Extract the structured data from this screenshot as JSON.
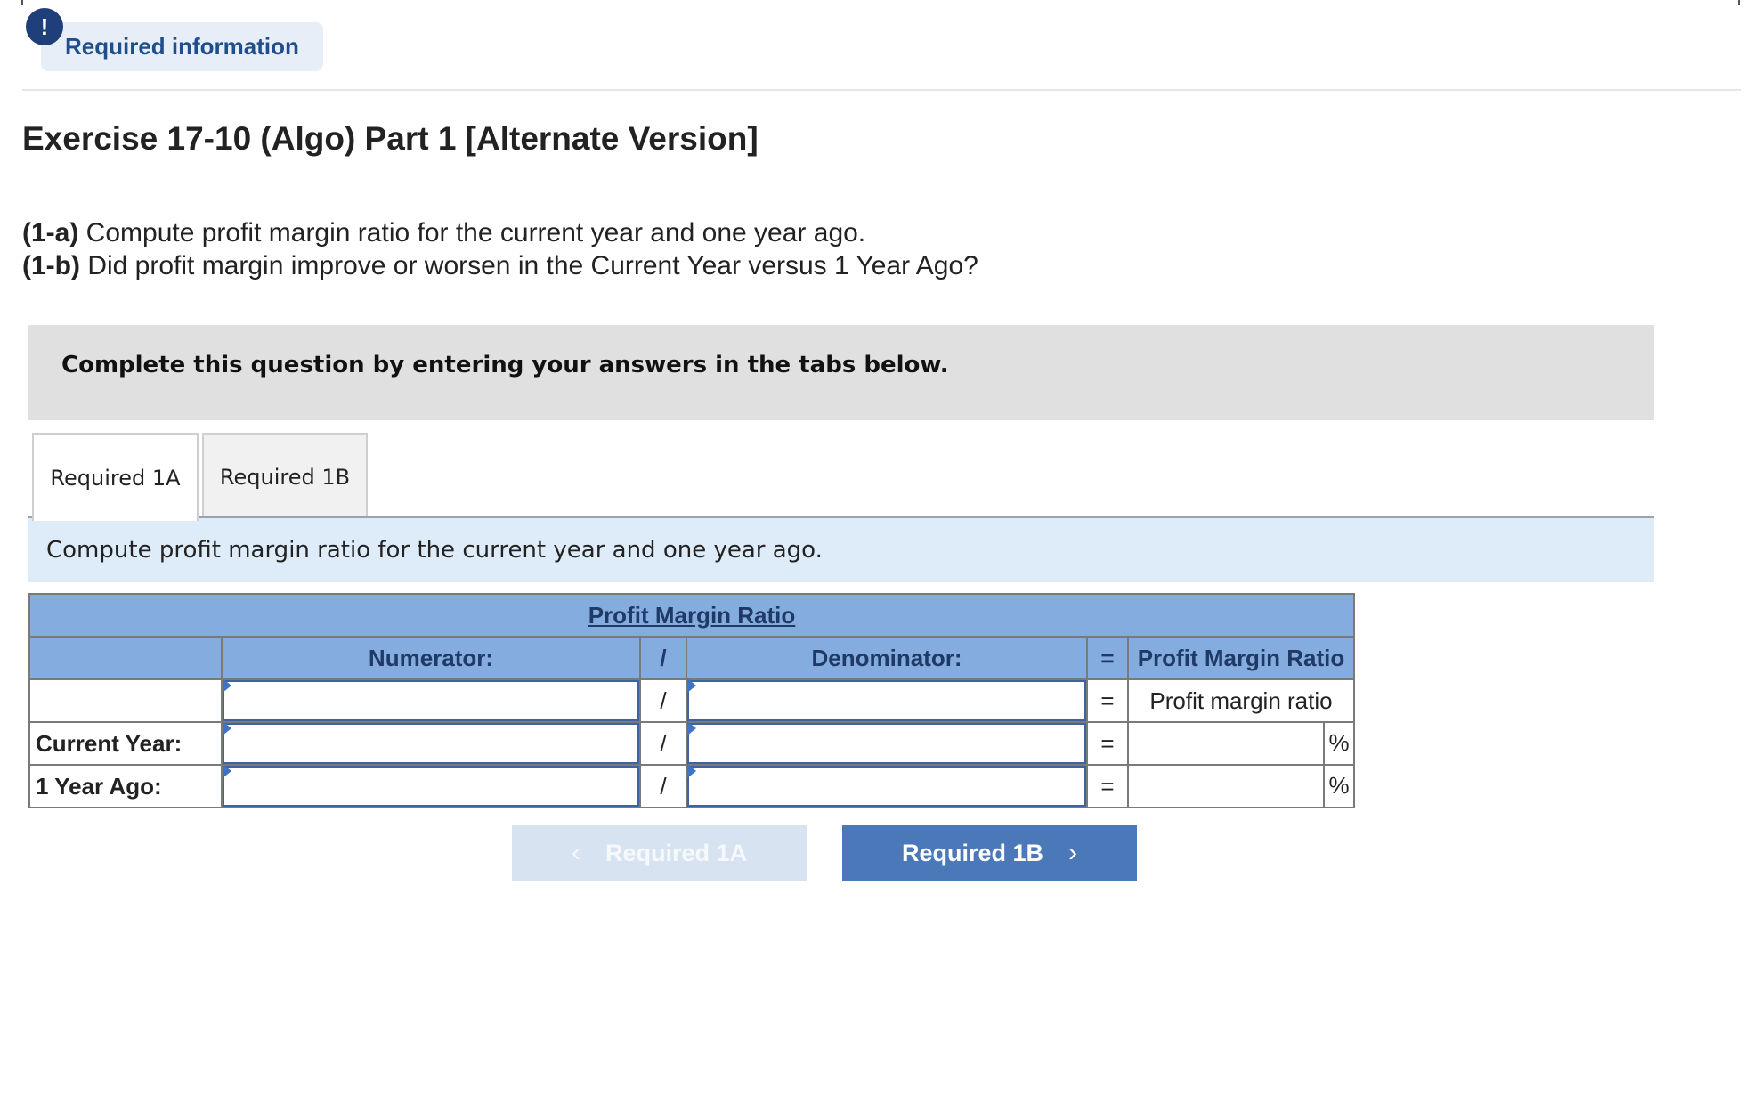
{
  "header": {
    "alert_icon": "!",
    "required_info_label": "Required information"
  },
  "exercise": {
    "title": "Exercise 17-10 (Algo) Part 1 [Alternate Version]",
    "q1a_label": "(1-a)",
    "q1a_text": " Compute profit margin ratio for the current year and one year ago.",
    "q1b_label": "(1-b)",
    "q1b_text": " Did profit margin improve or worsen in the Current Year versus 1 Year Ago?"
  },
  "instructions": "Complete this question by entering your answers in the tabs below.",
  "tabs": [
    {
      "label": "Required 1A",
      "active": true
    },
    {
      "label": "Required 1B",
      "active": false
    }
  ],
  "tab_description": "Compute profit margin ratio for the current year and one year ago.",
  "table": {
    "title": "Profit Margin Ratio",
    "headers": {
      "numerator": "Numerator:",
      "divide": "/",
      "denominator": "Denominator:",
      "equals": "=",
      "result": "Profit Margin Ratio"
    },
    "rows": [
      {
        "label": "",
        "numerator": "",
        "divide": "/",
        "denominator": "",
        "equals": "=",
        "result": "Profit margin ratio"
      },
      {
        "label": "Current Year:",
        "numerator": "",
        "divide": "/",
        "denominator": "",
        "equals": "=",
        "result": "",
        "unit": "%"
      },
      {
        "label": "1 Year Ago:",
        "numerator": "",
        "divide": "/",
        "denominator": "",
        "equals": "=",
        "result": "",
        "unit": "%"
      }
    ]
  },
  "nav": {
    "prev_label": "Required 1A",
    "next_label": "Required 1B",
    "prev_icon": "chevron-left-icon",
    "next_icon": "chevron-right-icon"
  },
  "colors": {
    "header_blue": "#84acde",
    "accent": "#4a78b9",
    "tab_desc_bg": "#deebf8",
    "instr_bg": "#e0e0e0"
  }
}
